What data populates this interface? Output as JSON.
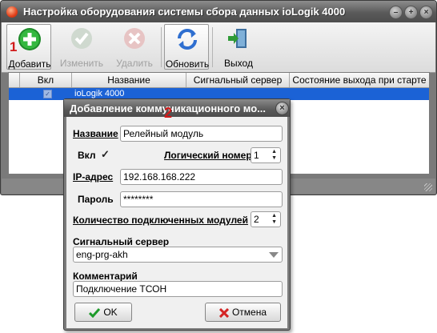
{
  "window": {
    "title": "Настройка оборудования системы сбора данных ioLogik 4000",
    "controls": [
      "minimize",
      "maximize",
      "close"
    ]
  },
  "toolbar": {
    "items": [
      {
        "label": "Добавить",
        "icon": "add-plus-icon",
        "enabled": true
      },
      {
        "label": "Изменить",
        "icon": "checkmark-icon",
        "enabled": false
      },
      {
        "label": "Удалить",
        "icon": "delete-x-icon",
        "enabled": false
      },
      {
        "label": "Обновить",
        "icon": "refresh-icon",
        "enabled": true
      },
      {
        "label": "Выход",
        "icon": "exit-door-icon",
        "enabled": true
      }
    ]
  },
  "grid": {
    "columns": [
      "Вкл",
      "Название",
      "Сигнальный сервер",
      "Состояние выхода при старте"
    ],
    "rows": [
      {
        "enabled": true,
        "name": "ioLogik 4000",
        "server": "",
        "state": ""
      }
    ]
  },
  "annotations": {
    "step1": "1",
    "step2": "2"
  },
  "dialog": {
    "title": "Добавление коммуникационного мо...",
    "name_label": "Название",
    "name_value": "Релейный модуль",
    "enabled_label": "Вкл",
    "enabled_checked": true,
    "logical_number_label": "Логический номер",
    "logical_number_value": "1",
    "ip_label": "IP-адрес",
    "ip_value": "192.168.168.222",
    "password_label": "Пароль",
    "password_value": "********",
    "modules_label": "Количество подключенных модулей",
    "modules_value": "2",
    "server_label": "Сигнальный сервер",
    "server_value": "eng-prg-akh",
    "comment_label": "Комментарий",
    "comment_value": "Подключение ТСОН",
    "ok_label": "OK",
    "cancel_label": "Отмена"
  },
  "colors": {
    "selection": "#1b62d6",
    "annotation": "#d01a1a",
    "titlebar": "#5a5a5a"
  }
}
